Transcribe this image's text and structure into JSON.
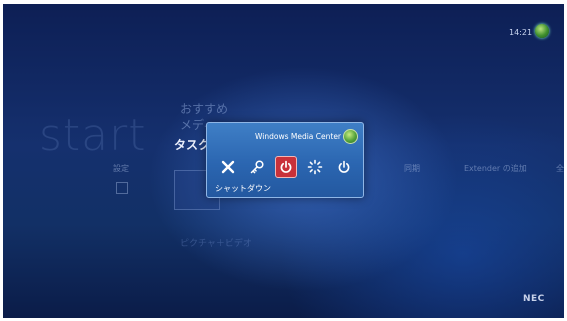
{
  "clock": "14:21",
  "start_text": "start",
  "menu": {
    "items": [
      "おすすめ",
      "メディ",
      "タスク"
    ],
    "active_index": 2
  },
  "task_strip": {
    "items": [
      "設定",
      "同期",
      "Extender の追加",
      "全"
    ],
    "bottom_item": "ピクチャ＋ビデオ"
  },
  "dialog": {
    "title": "Windows Media Center",
    "selected_label": "シャットダウン",
    "icons": [
      "close-icon",
      "key-icon",
      "power-shutdown-icon",
      "sleep-icon",
      "power-icon"
    ],
    "selected_index": 2
  },
  "brand": "NEC",
  "colors": {
    "background": "#15306e",
    "dialog": "#2b66b1",
    "selected": "#c9313a"
  }
}
